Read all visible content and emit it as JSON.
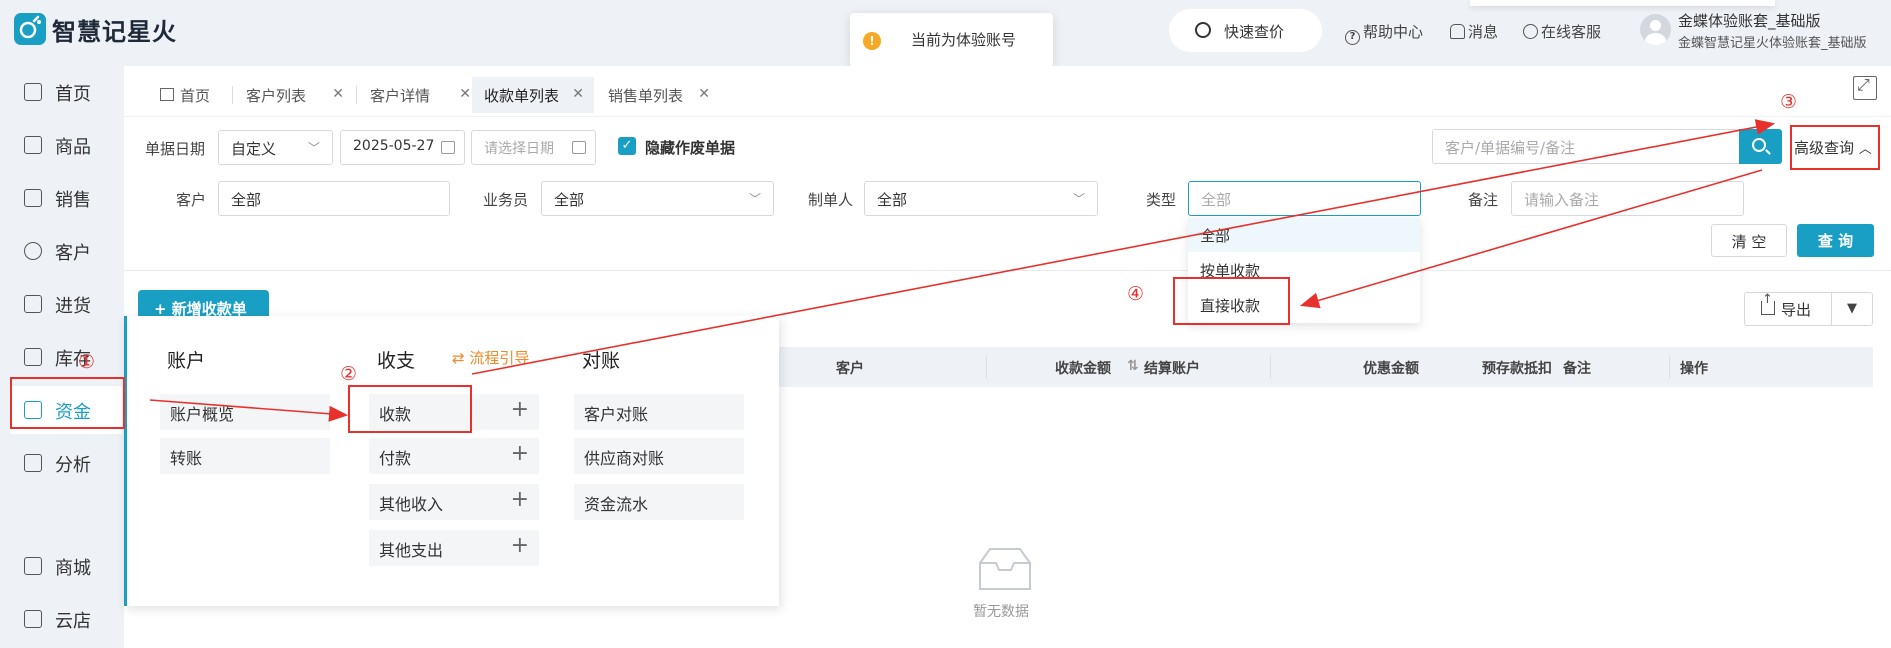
{
  "app": {
    "name": "智慧记星火"
  },
  "toast": {
    "text": "当前为体验账号"
  },
  "topbar": {
    "quick_price": "快速查价",
    "help": "帮助中心",
    "messages": "消息",
    "service": "在线客服",
    "account_name": "金蝶体验账套_基础版",
    "account_sub": "金蝶智慧记星火体验账套_基础版"
  },
  "sidebar": {
    "items": [
      {
        "label": "首页",
        "icon": "home-icon"
      },
      {
        "label": "商品",
        "icon": "bag-icon"
      },
      {
        "label": "销售",
        "icon": "clipboard-icon"
      },
      {
        "label": "客户",
        "icon": "user-icon"
      },
      {
        "label": "进货",
        "icon": "list-icon"
      },
      {
        "label": "库存",
        "icon": "warehouse-icon"
      },
      {
        "label": "资金",
        "icon": "wallet-icon"
      },
      {
        "label": "分析",
        "icon": "chart-icon"
      },
      {
        "label": "商城",
        "icon": "shop-icon"
      },
      {
        "label": "云店",
        "icon": "store-icon"
      }
    ],
    "active": "资金"
  },
  "tabs": [
    {
      "label": "首页"
    },
    {
      "label": "客户列表"
    },
    {
      "label": "客户详情"
    },
    {
      "label": "收款单列表",
      "active": true
    },
    {
      "label": "销售单列表"
    }
  ],
  "filters": {
    "date_label": "单据日期",
    "date_mode": "自定义",
    "date_start": "2025-05-27",
    "date_end_placeholder": "请选择日期",
    "hide_void": "隐藏作废单据",
    "search_placeholder": "客户/单据编号/备注",
    "advanced": "高级查询",
    "customer_label": "客户",
    "customer_value": "全部",
    "salesman_label": "业务员",
    "salesman_value": "全部",
    "maker_label": "制单人",
    "maker_value": "全部",
    "type_label": "类型",
    "type_placeholder": "全部",
    "remark_label": "备注",
    "remark_placeholder": "请输入备注",
    "clear": "清 空",
    "query": "查 询"
  },
  "type_options": [
    "全部",
    "按单收款",
    "直接收款"
  ],
  "actions": {
    "add": "+ 新增收款单",
    "export": "导出"
  },
  "table": {
    "headers": [
      "客户",
      "收款金额",
      "结算账户",
      "优惠金额",
      "预存款抵扣",
      "备注",
      "操作"
    ],
    "empty": "暂无数据"
  },
  "mega_menu": {
    "col1_title": "账户",
    "col1_items": [
      "账户概览",
      "转账"
    ],
    "col2_title": "收支",
    "guide": "流程引导",
    "col2_items": [
      "收款",
      "付款",
      "其他收入",
      "其他支出"
    ],
    "col3_title": "对账",
    "col3_items": [
      "客户对账",
      "供应商对账",
      "资金流水"
    ]
  },
  "annotations": [
    "①",
    "②",
    "③",
    "④"
  ],
  "colors": {
    "accent": "#1a9fc4",
    "annotation": "#e8312c",
    "guide": "#f08a2a"
  }
}
